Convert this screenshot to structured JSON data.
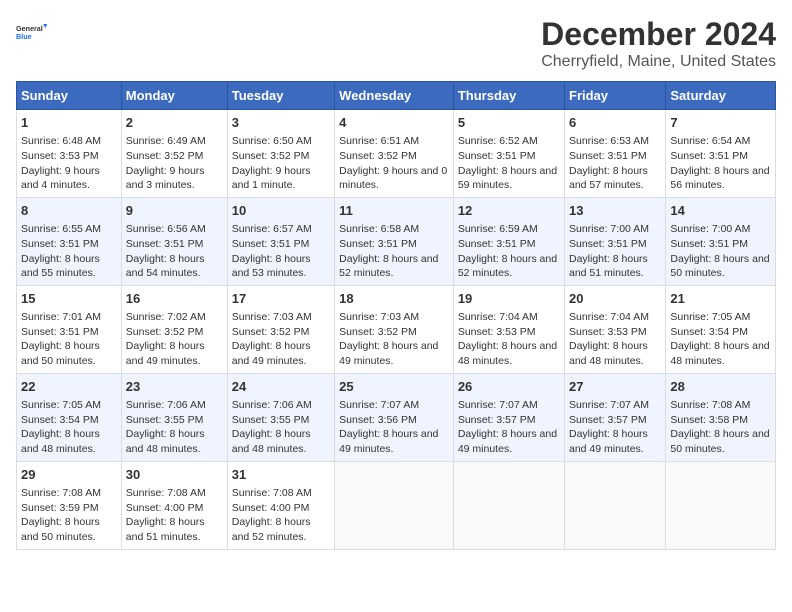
{
  "logo": {
    "line1": "General",
    "line2": "Blue"
  },
  "title": "December 2024",
  "subtitle": "Cherryfield, Maine, United States",
  "days_of_week": [
    "Sunday",
    "Monday",
    "Tuesday",
    "Wednesday",
    "Thursday",
    "Friday",
    "Saturday"
  ],
  "weeks": [
    [
      {
        "day": "1",
        "sunrise": "6:48 AM",
        "sunset": "3:53 PM",
        "daylight": "9 hours and 4 minutes."
      },
      {
        "day": "2",
        "sunrise": "6:49 AM",
        "sunset": "3:52 PM",
        "daylight": "9 hours and 3 minutes."
      },
      {
        "day": "3",
        "sunrise": "6:50 AM",
        "sunset": "3:52 PM",
        "daylight": "9 hours and 1 minute."
      },
      {
        "day": "4",
        "sunrise": "6:51 AM",
        "sunset": "3:52 PM",
        "daylight": "9 hours and 0 minutes."
      },
      {
        "day": "5",
        "sunrise": "6:52 AM",
        "sunset": "3:51 PM",
        "daylight": "8 hours and 59 minutes."
      },
      {
        "day": "6",
        "sunrise": "6:53 AM",
        "sunset": "3:51 PM",
        "daylight": "8 hours and 57 minutes."
      },
      {
        "day": "7",
        "sunrise": "6:54 AM",
        "sunset": "3:51 PM",
        "daylight": "8 hours and 56 minutes."
      }
    ],
    [
      {
        "day": "8",
        "sunrise": "6:55 AM",
        "sunset": "3:51 PM",
        "daylight": "8 hours and 55 minutes."
      },
      {
        "day": "9",
        "sunrise": "6:56 AM",
        "sunset": "3:51 PM",
        "daylight": "8 hours and 54 minutes."
      },
      {
        "day": "10",
        "sunrise": "6:57 AM",
        "sunset": "3:51 PM",
        "daylight": "8 hours and 53 minutes."
      },
      {
        "day": "11",
        "sunrise": "6:58 AM",
        "sunset": "3:51 PM",
        "daylight": "8 hours and 52 minutes."
      },
      {
        "day": "12",
        "sunrise": "6:59 AM",
        "sunset": "3:51 PM",
        "daylight": "8 hours and 52 minutes."
      },
      {
        "day": "13",
        "sunrise": "7:00 AM",
        "sunset": "3:51 PM",
        "daylight": "8 hours and 51 minutes."
      },
      {
        "day": "14",
        "sunrise": "7:00 AM",
        "sunset": "3:51 PM",
        "daylight": "8 hours and 50 minutes."
      }
    ],
    [
      {
        "day": "15",
        "sunrise": "7:01 AM",
        "sunset": "3:51 PM",
        "daylight": "8 hours and 50 minutes."
      },
      {
        "day": "16",
        "sunrise": "7:02 AM",
        "sunset": "3:52 PM",
        "daylight": "8 hours and 49 minutes."
      },
      {
        "day": "17",
        "sunrise": "7:03 AM",
        "sunset": "3:52 PM",
        "daylight": "8 hours and 49 minutes."
      },
      {
        "day": "18",
        "sunrise": "7:03 AM",
        "sunset": "3:52 PM",
        "daylight": "8 hours and 49 minutes."
      },
      {
        "day": "19",
        "sunrise": "7:04 AM",
        "sunset": "3:53 PM",
        "daylight": "8 hours and 48 minutes."
      },
      {
        "day": "20",
        "sunrise": "7:04 AM",
        "sunset": "3:53 PM",
        "daylight": "8 hours and 48 minutes."
      },
      {
        "day": "21",
        "sunrise": "7:05 AM",
        "sunset": "3:54 PM",
        "daylight": "8 hours and 48 minutes."
      }
    ],
    [
      {
        "day": "22",
        "sunrise": "7:05 AM",
        "sunset": "3:54 PM",
        "daylight": "8 hours and 48 minutes."
      },
      {
        "day": "23",
        "sunrise": "7:06 AM",
        "sunset": "3:55 PM",
        "daylight": "8 hours and 48 minutes."
      },
      {
        "day": "24",
        "sunrise": "7:06 AM",
        "sunset": "3:55 PM",
        "daylight": "8 hours and 48 minutes."
      },
      {
        "day": "25",
        "sunrise": "7:07 AM",
        "sunset": "3:56 PM",
        "daylight": "8 hours and 49 minutes."
      },
      {
        "day": "26",
        "sunrise": "7:07 AM",
        "sunset": "3:57 PM",
        "daylight": "8 hours and 49 minutes."
      },
      {
        "day": "27",
        "sunrise": "7:07 AM",
        "sunset": "3:57 PM",
        "daylight": "8 hours and 49 minutes."
      },
      {
        "day": "28",
        "sunrise": "7:08 AM",
        "sunset": "3:58 PM",
        "daylight": "8 hours and 50 minutes."
      }
    ],
    [
      {
        "day": "29",
        "sunrise": "7:08 AM",
        "sunset": "3:59 PM",
        "daylight": "8 hours and 50 minutes."
      },
      {
        "day": "30",
        "sunrise": "7:08 AM",
        "sunset": "4:00 PM",
        "daylight": "8 hours and 51 minutes."
      },
      {
        "day": "31",
        "sunrise": "7:08 AM",
        "sunset": "4:00 PM",
        "daylight": "8 hours and 52 minutes."
      },
      null,
      null,
      null,
      null
    ]
  ]
}
